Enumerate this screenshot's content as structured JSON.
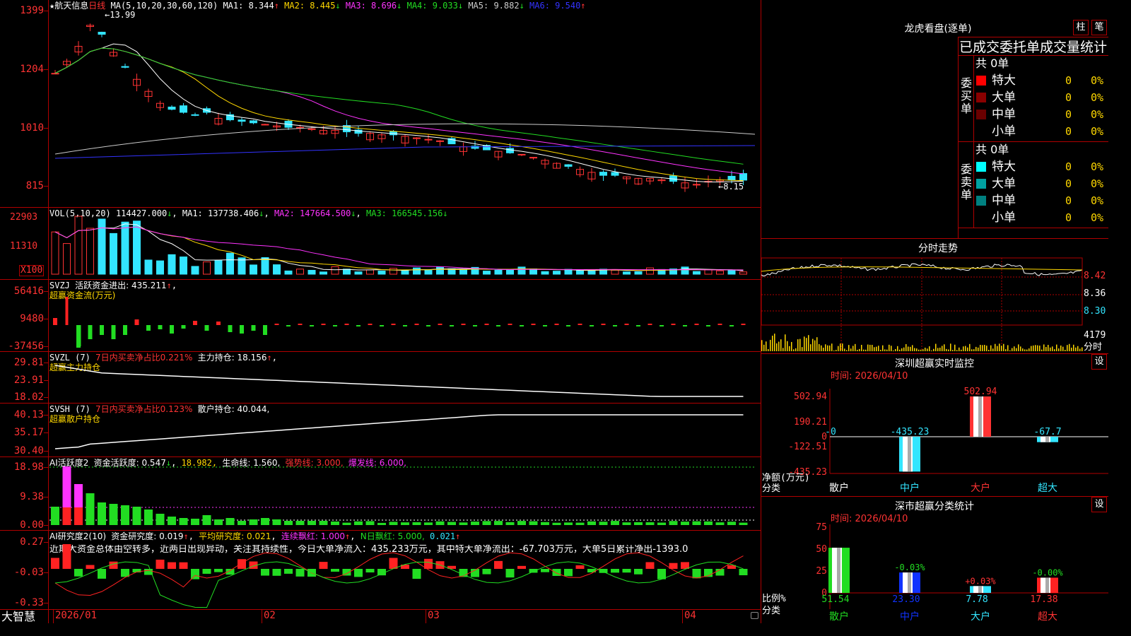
{
  "stock": {
    "star": "★",
    "name": "航天信息",
    "period": "日线",
    "ma_params": "MA(5,10,20,30,60,120)"
  },
  "kline": {
    "y_ticks": [
      "1399",
      "1204",
      "1010",
      "815"
    ],
    "high_label": "13.99",
    "low_label": "8.15",
    "ma": [
      {
        "label": "MA1: 8.344",
        "arrow": "↑",
        "color": "#ffffff"
      },
      {
        "label": "MA2: 8.445",
        "arrow": "↓",
        "color": "#ffd800"
      },
      {
        "label": "MA3: 8.696",
        "arrow": "↓",
        "color": "#ff33ff"
      },
      {
        "label": "MA4: 9.033",
        "arrow": "↓",
        "color": "#22dd22"
      },
      {
        "label": "MA5: 9.882",
        "arrow": "↓",
        "color": "#cccccc"
      },
      {
        "label": "MA6: 9.540",
        "arrow": "↑",
        "color": "#3333ff"
      }
    ]
  },
  "vol": {
    "title": "VOL(5,10,20)",
    "value": "114427.000",
    "arrow": "↓",
    "ma1": "MA1: 137738.406",
    "ma1_arrow": "↓",
    "ma2": "MA2: 147664.500",
    "ma2_arrow": "↓",
    "ma3": "MA3: 166545.156",
    "ma3_arrow": "↓",
    "y_ticks": [
      "22903",
      "11310"
    ],
    "unit": "X100"
  },
  "svzj": {
    "title": "SVZJ",
    "label": "活跃资金进出: 435.211",
    "arrow": "↑",
    "sub": "超赢资金流(万元)",
    "y_ticks": [
      "56416",
      "9480",
      "-37456"
    ]
  },
  "svzl": {
    "title": "SVZL (7)",
    "red": "7日内买卖净占比0.221%",
    "white": "主力持仓: 18.156",
    "arrow": "↑",
    "sub": "超赢主力持仓",
    "y_ticks": [
      "29.81",
      "23.91",
      "18.02"
    ]
  },
  "svsh": {
    "title": "SVSH (7)",
    "red": "7日内买卖净占比0.123%",
    "white": "散户持仓: 40.044,",
    "sub": "超赢散户持仓",
    "y_ticks": [
      "40.13",
      "35.17",
      "30.40"
    ]
  },
  "ai1": {
    "title": "AI活跃度2",
    "a": "资金活跃度: 0.547",
    "a_arrow": "↓",
    "b": "18.982,",
    "c": "生命线: 1.560,",
    "d": "强势线: 3.000,",
    "e": "爆发线: 6.000,",
    "y_ticks": [
      "18.98",
      "9.38",
      "0.00"
    ]
  },
  "ai2": {
    "title": "AI研究度2(10)",
    "a": "资金研究度: 0.019",
    "a_arrow": "↑",
    "b": "平均研究度: 0.021",
    "c": "连续飘红: 1.000",
    "c_arrow": "↑",
    "d": "N日飘红: 5.000,",
    "e": "0.021",
    "e_arrow": "↑",
    "comment": "近期大资金总体由空转多，近两日出现异动，关注其持续性，今日大单净流入：435.233万元，其中特大单净流出：-67.703万元，大单5日累计净出-1393.0",
    "y_ticks": [
      "0.27",
      "-0.03",
      "-0.33"
    ]
  },
  "xaxis": {
    "labels": [
      "2026/01",
      "02",
      "03",
      "04"
    ],
    "brand": "大智慧"
  },
  "dragon": {
    "title": "龙虎看盘(逐单)",
    "btn1": "柱",
    "btn2": "笔",
    "header": "已成交委托单成交量统计",
    "buy": {
      "side": "委买单",
      "total": "共 0单",
      "rows": [
        {
          "name": "特大",
          "v": "0",
          "p": "0%",
          "c": "#ff0000"
        },
        {
          "name": "大单",
          "v": "0",
          "p": "0%",
          "c": "#8a0000"
        },
        {
          "name": "中单",
          "v": "0",
          "p": "0%",
          "c": "#6a0000"
        },
        {
          "name": "小单",
          "v": "0",
          "p": "0%",
          "c": "#000000"
        }
      ]
    },
    "sell": {
      "side": "委卖单",
      "total": "共 0单",
      "rows": [
        {
          "name": "特大",
          "v": "0",
          "p": "0%",
          "c": "#00ffff"
        },
        {
          "name": "大单",
          "v": "0",
          "p": "0%",
          "c": "#00a0a0"
        },
        {
          "name": "中单",
          "v": "0",
          "p": "0%",
          "c": "#008080"
        },
        {
          "name": "小单",
          "v": "0",
          "p": "0%",
          "c": "#000000"
        }
      ]
    }
  },
  "intraday": {
    "title": "分时走势",
    "y_ticks": [
      "8.42",
      "8.36",
      "8.30"
    ],
    "vol_tick": "4179",
    "vol_unit": "分时"
  },
  "sz_monitor": {
    "title": "深圳超赢实时监控",
    "btn": "设",
    "time": "时间: 2026/04/10",
    "y_ticks": [
      "502.94",
      "190.21",
      "0",
      "-122.51",
      "-435.23"
    ],
    "bars": [
      {
        "cat": "散户",
        "val": "-0"
      },
      {
        "cat": "中户",
        "val": "-435.23"
      },
      {
        "cat": "大户",
        "val": "502.94"
      },
      {
        "cat": "超大",
        "val": "-67.7"
      }
    ],
    "axis_label": "净额(万元)",
    "axis_label2": "分类"
  },
  "sz_class": {
    "title": "深市超赢分类统计",
    "btn": "设",
    "time": "时间: 2026/04/10",
    "y_ticks": [
      "75",
      "50",
      "25",
      "0"
    ],
    "bars": [
      {
        "cat": "散户",
        "top": "",
        "val": "51.54"
      },
      {
        "cat": "中户",
        "top": "-0.03%",
        "val": "23.30"
      },
      {
        "cat": "大户",
        "top": "+0.03%",
        "val": "7.78"
      },
      {
        "cat": "超大",
        "top": "-0.00%",
        "val": "17.38"
      }
    ],
    "axis_label": "比例%",
    "axis_label2": "分类"
  }
}
